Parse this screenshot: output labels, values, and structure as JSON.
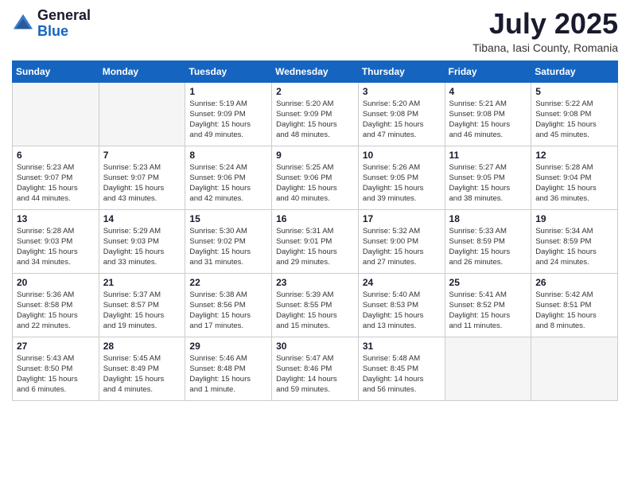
{
  "header": {
    "logo_general": "General",
    "logo_blue": "Blue",
    "month_title": "July 2025",
    "location": "Tibana, Iasi County, Romania"
  },
  "days_of_week": [
    "Sunday",
    "Monday",
    "Tuesday",
    "Wednesday",
    "Thursday",
    "Friday",
    "Saturday"
  ],
  "weeks": [
    [
      {
        "day": "",
        "info": ""
      },
      {
        "day": "",
        "info": ""
      },
      {
        "day": "1",
        "info": "Sunrise: 5:19 AM\nSunset: 9:09 PM\nDaylight: 15 hours\nand 49 minutes."
      },
      {
        "day": "2",
        "info": "Sunrise: 5:20 AM\nSunset: 9:09 PM\nDaylight: 15 hours\nand 48 minutes."
      },
      {
        "day": "3",
        "info": "Sunrise: 5:20 AM\nSunset: 9:08 PM\nDaylight: 15 hours\nand 47 minutes."
      },
      {
        "day": "4",
        "info": "Sunrise: 5:21 AM\nSunset: 9:08 PM\nDaylight: 15 hours\nand 46 minutes."
      },
      {
        "day": "5",
        "info": "Sunrise: 5:22 AM\nSunset: 9:08 PM\nDaylight: 15 hours\nand 45 minutes."
      }
    ],
    [
      {
        "day": "6",
        "info": "Sunrise: 5:23 AM\nSunset: 9:07 PM\nDaylight: 15 hours\nand 44 minutes."
      },
      {
        "day": "7",
        "info": "Sunrise: 5:23 AM\nSunset: 9:07 PM\nDaylight: 15 hours\nand 43 minutes."
      },
      {
        "day": "8",
        "info": "Sunrise: 5:24 AM\nSunset: 9:06 PM\nDaylight: 15 hours\nand 42 minutes."
      },
      {
        "day": "9",
        "info": "Sunrise: 5:25 AM\nSunset: 9:06 PM\nDaylight: 15 hours\nand 40 minutes."
      },
      {
        "day": "10",
        "info": "Sunrise: 5:26 AM\nSunset: 9:05 PM\nDaylight: 15 hours\nand 39 minutes."
      },
      {
        "day": "11",
        "info": "Sunrise: 5:27 AM\nSunset: 9:05 PM\nDaylight: 15 hours\nand 38 minutes."
      },
      {
        "day": "12",
        "info": "Sunrise: 5:28 AM\nSunset: 9:04 PM\nDaylight: 15 hours\nand 36 minutes."
      }
    ],
    [
      {
        "day": "13",
        "info": "Sunrise: 5:28 AM\nSunset: 9:03 PM\nDaylight: 15 hours\nand 34 minutes."
      },
      {
        "day": "14",
        "info": "Sunrise: 5:29 AM\nSunset: 9:03 PM\nDaylight: 15 hours\nand 33 minutes."
      },
      {
        "day": "15",
        "info": "Sunrise: 5:30 AM\nSunset: 9:02 PM\nDaylight: 15 hours\nand 31 minutes."
      },
      {
        "day": "16",
        "info": "Sunrise: 5:31 AM\nSunset: 9:01 PM\nDaylight: 15 hours\nand 29 minutes."
      },
      {
        "day": "17",
        "info": "Sunrise: 5:32 AM\nSunset: 9:00 PM\nDaylight: 15 hours\nand 27 minutes."
      },
      {
        "day": "18",
        "info": "Sunrise: 5:33 AM\nSunset: 8:59 PM\nDaylight: 15 hours\nand 26 minutes."
      },
      {
        "day": "19",
        "info": "Sunrise: 5:34 AM\nSunset: 8:59 PM\nDaylight: 15 hours\nand 24 minutes."
      }
    ],
    [
      {
        "day": "20",
        "info": "Sunrise: 5:36 AM\nSunset: 8:58 PM\nDaylight: 15 hours\nand 22 minutes."
      },
      {
        "day": "21",
        "info": "Sunrise: 5:37 AM\nSunset: 8:57 PM\nDaylight: 15 hours\nand 19 minutes."
      },
      {
        "day": "22",
        "info": "Sunrise: 5:38 AM\nSunset: 8:56 PM\nDaylight: 15 hours\nand 17 minutes."
      },
      {
        "day": "23",
        "info": "Sunrise: 5:39 AM\nSunset: 8:55 PM\nDaylight: 15 hours\nand 15 minutes."
      },
      {
        "day": "24",
        "info": "Sunrise: 5:40 AM\nSunset: 8:53 PM\nDaylight: 15 hours\nand 13 minutes."
      },
      {
        "day": "25",
        "info": "Sunrise: 5:41 AM\nSunset: 8:52 PM\nDaylight: 15 hours\nand 11 minutes."
      },
      {
        "day": "26",
        "info": "Sunrise: 5:42 AM\nSunset: 8:51 PM\nDaylight: 15 hours\nand 8 minutes."
      }
    ],
    [
      {
        "day": "27",
        "info": "Sunrise: 5:43 AM\nSunset: 8:50 PM\nDaylight: 15 hours\nand 6 minutes."
      },
      {
        "day": "28",
        "info": "Sunrise: 5:45 AM\nSunset: 8:49 PM\nDaylight: 15 hours\nand 4 minutes."
      },
      {
        "day": "29",
        "info": "Sunrise: 5:46 AM\nSunset: 8:48 PM\nDaylight: 15 hours\nand 1 minute."
      },
      {
        "day": "30",
        "info": "Sunrise: 5:47 AM\nSunset: 8:46 PM\nDaylight: 14 hours\nand 59 minutes."
      },
      {
        "day": "31",
        "info": "Sunrise: 5:48 AM\nSunset: 8:45 PM\nDaylight: 14 hours\nand 56 minutes."
      },
      {
        "day": "",
        "info": ""
      },
      {
        "day": "",
        "info": ""
      }
    ]
  ]
}
